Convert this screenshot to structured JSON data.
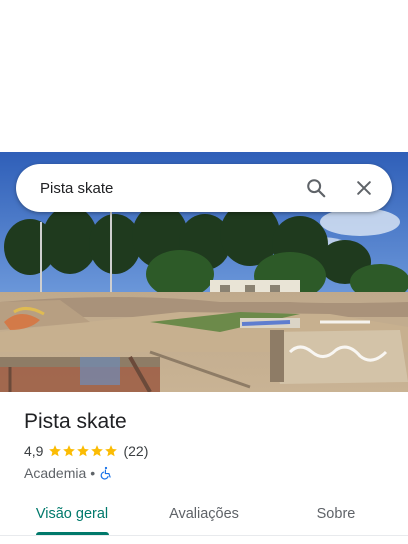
{
  "search": {
    "value": "Pista skate",
    "search_icon": "search-icon",
    "close_icon": "close-icon"
  },
  "photo": {
    "subject": "skatepark-photo"
  },
  "place": {
    "title": "Pista skate",
    "rating": "4,9",
    "stars": 5,
    "reviews": "(22)",
    "category": "Academia",
    "separator": "•",
    "accessibility_icon": "wheelchair-icon"
  },
  "tabs": [
    {
      "label": "Visão geral",
      "selected": true
    },
    {
      "label": "Avaliações",
      "selected": false
    },
    {
      "label": "Sobre",
      "selected": false
    }
  ],
  "colors": {
    "accent": "#00796b",
    "star": "#fbbc04",
    "accessibility": "#1a73e8"
  }
}
